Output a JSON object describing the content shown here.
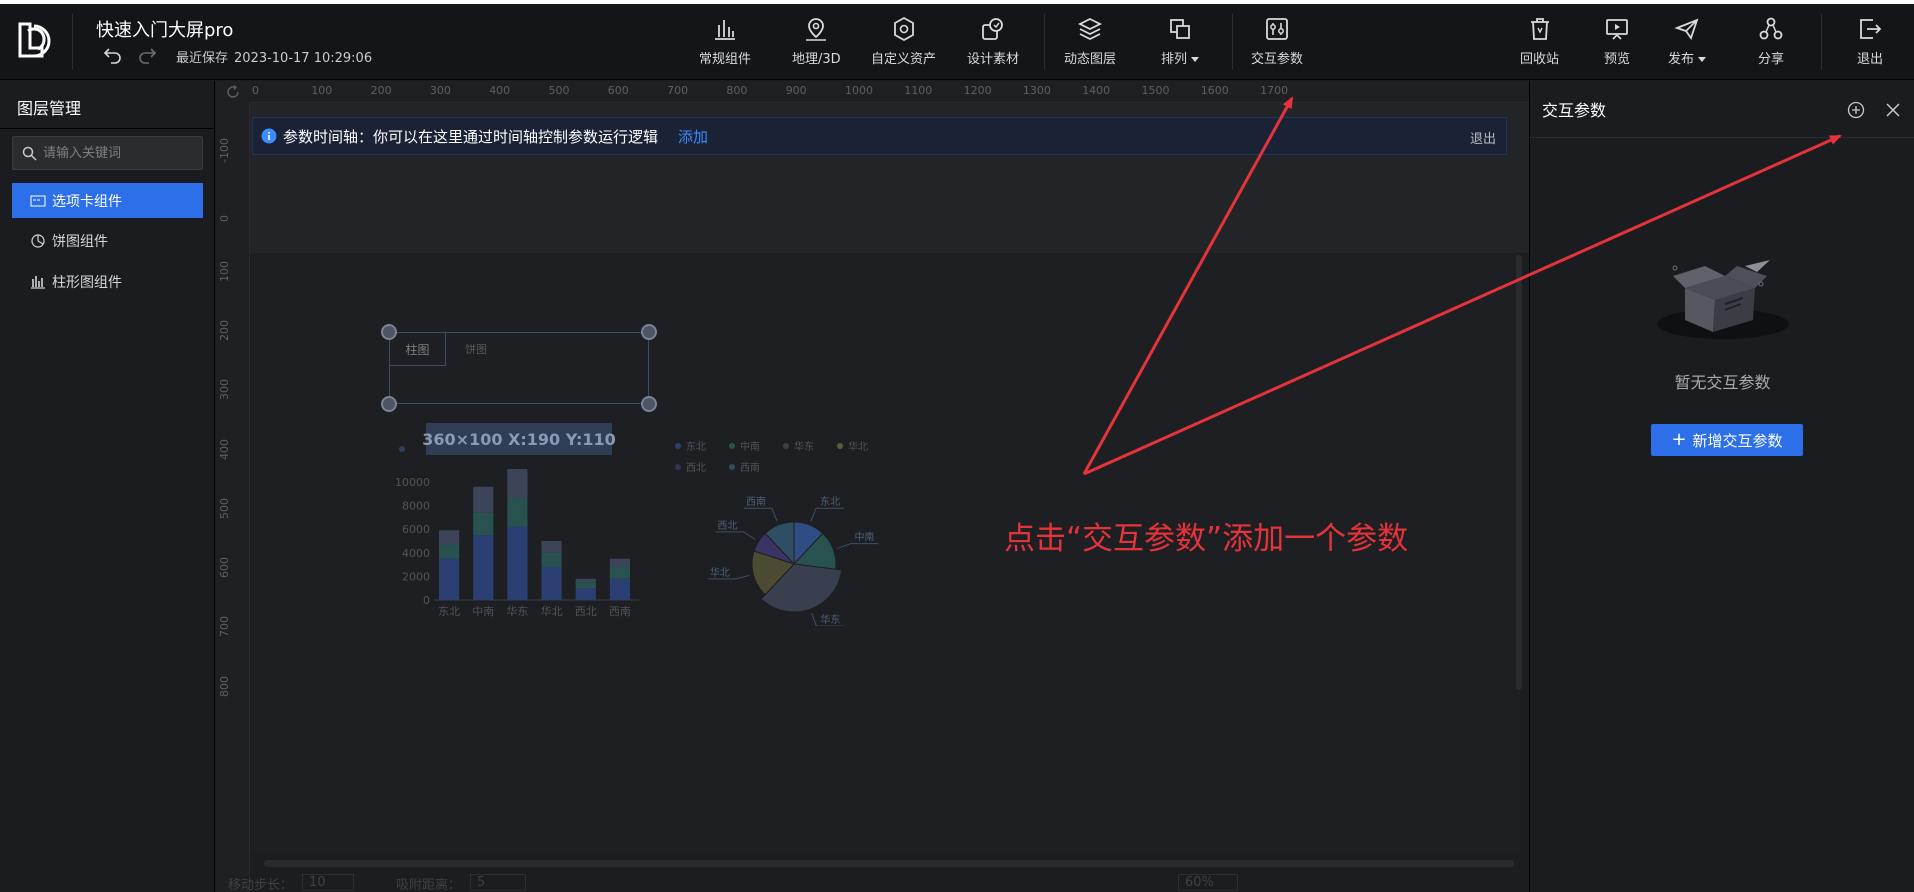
{
  "header": {
    "project_title": "快速入门大屏pro",
    "save_label": "最近保存",
    "save_time": "2023-10-17 10:29:06",
    "tools_center": [
      {
        "label": "常规组件",
        "icon": "bar-chart-icon"
      },
      {
        "label": "地理/3D",
        "icon": "map-pin-icon"
      },
      {
        "label": "自定义资产",
        "icon": "hexagon-icon"
      },
      {
        "label": "设计素材",
        "icon": "material-icon"
      },
      {
        "label": "动态图层",
        "icon": "layers-icon"
      },
      {
        "label": "排列",
        "icon": "arrange-icon"
      },
      {
        "label": "交互参数",
        "icon": "params-icon"
      }
    ],
    "tools_right": [
      {
        "label": "回收站",
        "icon": "trash-icon"
      },
      {
        "label": "预览",
        "icon": "preview-icon"
      },
      {
        "label": "发布",
        "icon": "send-icon"
      },
      {
        "label": "分享",
        "icon": "share-icon"
      },
      {
        "label": "退出",
        "icon": "exit-icon"
      }
    ]
  },
  "left_panel": {
    "title": "图层管理",
    "search_placeholder": "请输入关键词",
    "layers": [
      {
        "label": "选项卡组件",
        "icon": "tab-icon",
        "active": true
      },
      {
        "label": "饼图组件",
        "icon": "pie-icon",
        "active": false
      },
      {
        "label": "柱形图组件",
        "icon": "bar-icon",
        "active": false
      }
    ]
  },
  "canvas": {
    "ruler_h": [
      "0",
      "100",
      "200",
      "300",
      "400",
      "500",
      "600",
      "700",
      "800",
      "900",
      "1000",
      "1100",
      "1200",
      "1300",
      "1400",
      "1500",
      "1600",
      "1700"
    ],
    "ruler_v": [
      "-100",
      "0",
      "100",
      "200",
      "300",
      "400",
      "500",
      "600",
      "700",
      "800"
    ],
    "banner": {
      "text": "参数时间轴：你可以在这里通过时间轴控制参数运行逻辑",
      "add": "添加",
      "exit": "退出"
    },
    "tab_widget": {
      "tab1": "柱图",
      "tab2": "饼图"
    },
    "dim_tip": "360×100   X:190 Y:110",
    "bottom_bar": {
      "step_label": "移动步长：",
      "step_value": "10",
      "snap_label": "吸附距离：",
      "snap_value": "5",
      "zoom": "60%"
    }
  },
  "chart_data": [
    {
      "type": "bar",
      "title": "",
      "categories": [
        "东北",
        "中南",
        "华东",
        "华北",
        "西北",
        "西南"
      ],
      "series": [
        {
          "values": [
            3500,
            5500,
            6200,
            2800,
            1000,
            1800
          ]
        },
        {
          "values": [
            1200,
            1900,
            2400,
            1200,
            500,
            1000
          ]
        },
        {
          "values": [
            1200,
            2200,
            2500,
            1000,
            300,
            700
          ]
        }
      ],
      "y_ticks": [
        "10000",
        "8000",
        "6000",
        "4000",
        "2000",
        "0"
      ],
      "ylim": [
        0,
        10000
      ]
    },
    {
      "type": "pie",
      "title": "",
      "legend": [
        "东北",
        "中南",
        "华东",
        "华北",
        "西北",
        "西南"
      ],
      "slices": [
        {
          "label": "东北",
          "value": 12
        },
        {
          "label": "中南",
          "value": 15
        },
        {
          "label": "华东",
          "value": 35
        },
        {
          "label": "华北",
          "value": 18
        },
        {
          "label": "西北",
          "value": 8
        },
        {
          "label": "西南",
          "value": 12
        }
      ]
    }
  ],
  "right_panel": {
    "title": "交互参数",
    "empty_text": "暂无交互参数",
    "add_button": "新增交互参数",
    "add_button_plus": "+"
  },
  "annotation": {
    "text": "点击“交互参数”添加一个参数",
    "color": "#e5333b"
  },
  "colors": {
    "accent": "#2d6fe8",
    "link": "#3c8cff",
    "header_bg": "#141518"
  }
}
